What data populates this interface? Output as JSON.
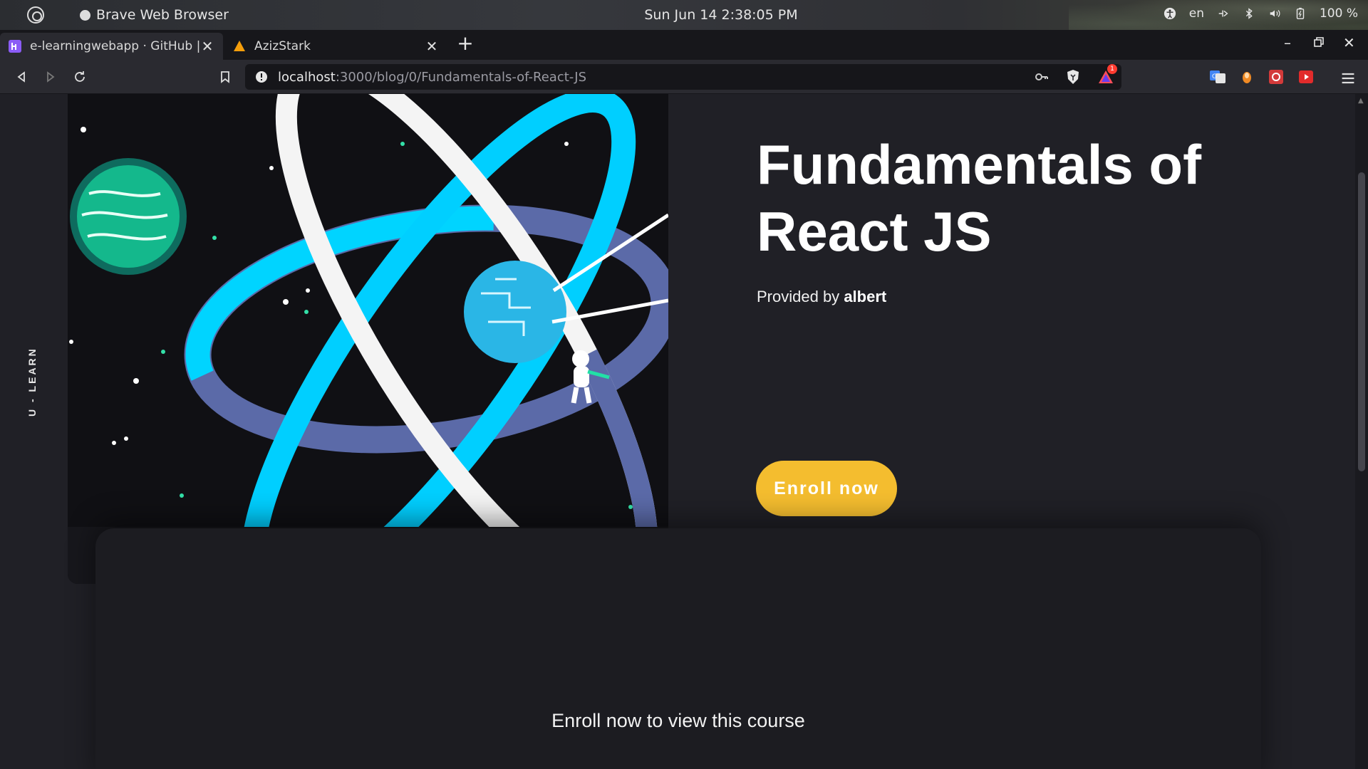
{
  "os": {
    "app_name": "Brave Web Browser",
    "clock": "Sun Jun 14   2:38:05 PM",
    "lang": "en",
    "battery": "100 %"
  },
  "tabs": [
    {
      "label": "e-learningwebapp · GitHub | H",
      "favicon_color": "#8b5cf6"
    },
    {
      "label": "AzizStark",
      "favicon_color": "#f59e0b"
    }
  ],
  "address_bar": {
    "host": "localhost",
    "path": ":3000/blog/0/Fundamentals-of-React-JS"
  },
  "extensions": {
    "brave_rewards_badge": "1"
  },
  "page": {
    "brand": "U - LEARN",
    "title": "Fundamentals of React JS",
    "provided_prefix": "Provided by",
    "author": "albert",
    "enroll_label": "Enroll now",
    "locked_message": "Enroll now to view this course",
    "accent_color": "#f4bd2f",
    "background_color": "#202026"
  }
}
